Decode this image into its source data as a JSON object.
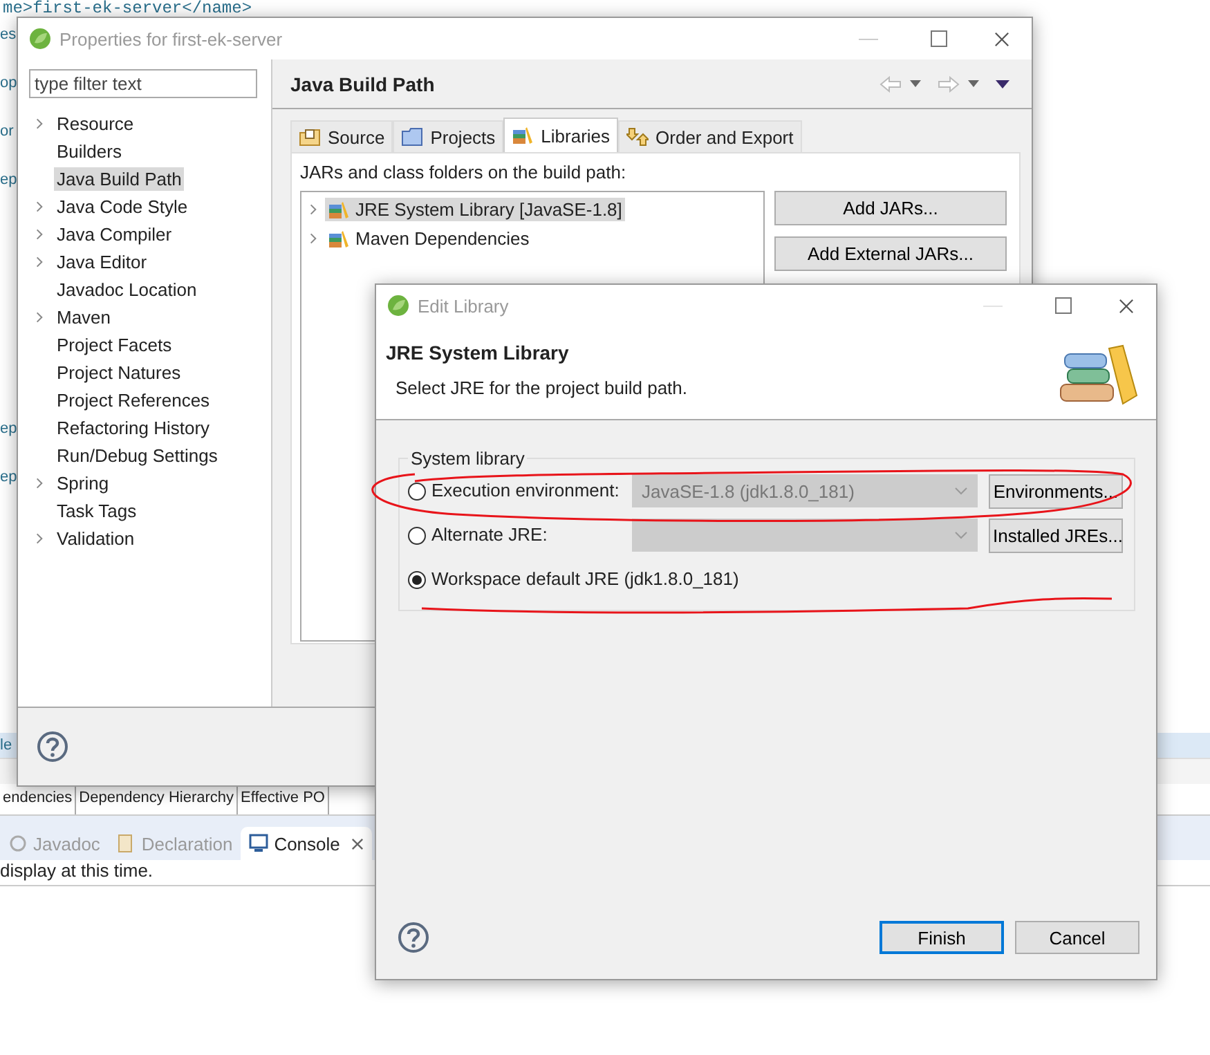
{
  "background_editor": {
    "code_line": "me>first-ek-server</name>",
    "margin_fragments_top": [
      "es",
      "op",
      "or",
      "ep"
    ],
    "margin_fragments_bottom": [
      "ep",
      "ep"
    ],
    "selected_fragment": "le",
    "editor_tabs": [
      {
        "label": "endencies"
      },
      {
        "label": "Dependency Hierarchy"
      },
      {
        "label": "Effective PO"
      }
    ],
    "views": [
      {
        "label": "Javadoc",
        "kind": "javadoc",
        "selected": false
      },
      {
        "label": "Declaration",
        "kind": "declaration",
        "selected": false
      },
      {
        "label": "Console",
        "kind": "console",
        "selected": true
      }
    ],
    "console_text": "display at this time."
  },
  "properties_window": {
    "title": "Properties for first-ek-server",
    "filter": {
      "placeholder": "type filter text"
    },
    "tree": [
      {
        "label": "Resource",
        "expandable": true,
        "selected": false
      },
      {
        "label": "Builders",
        "expandable": false,
        "selected": false
      },
      {
        "label": "Java Build Path",
        "expandable": false,
        "selected": true
      },
      {
        "label": "Java Code Style",
        "expandable": true,
        "selected": false
      },
      {
        "label": "Java Compiler",
        "expandable": true,
        "selected": false
      },
      {
        "label": "Java Editor",
        "expandable": true,
        "selected": false
      },
      {
        "label": "Javadoc Location",
        "expandable": false,
        "selected": false
      },
      {
        "label": "Maven",
        "expandable": true,
        "selected": false
      },
      {
        "label": "Project Facets",
        "expandable": false,
        "selected": false
      },
      {
        "label": "Project Natures",
        "expandable": false,
        "selected": false
      },
      {
        "label": "Project References",
        "expandable": false,
        "selected": false
      },
      {
        "label": "Refactoring History",
        "expandable": false,
        "selected": false
      },
      {
        "label": "Run/Debug Settings",
        "expandable": false,
        "selected": false
      },
      {
        "label": "Spring",
        "expandable": true,
        "selected": false
      },
      {
        "label": "Task Tags",
        "expandable": false,
        "selected": false
      },
      {
        "label": "Validation",
        "expandable": true,
        "selected": false
      }
    ],
    "page_title": "Java Build Path",
    "tabs": [
      {
        "label": "Source",
        "kind": "source",
        "selected": false
      },
      {
        "label": "Projects",
        "kind": "projects",
        "selected": false
      },
      {
        "label": "Libraries",
        "kind": "libraries",
        "selected": true
      },
      {
        "label": "Order and Export",
        "kind": "order",
        "selected": false
      }
    ],
    "content_label": "JARs and class folders on the build path:",
    "libraries": [
      {
        "label": "JRE System Library [JavaSE-1.8]",
        "selected": true
      },
      {
        "label": "Maven Dependencies",
        "selected": false
      }
    ],
    "buttons": [
      "Add JARs...",
      "Add External JARs..."
    ]
  },
  "edit_library": {
    "title": "Edit Library",
    "heading": "JRE System Library",
    "description": "Select JRE for the project build path.",
    "group_label": "System library",
    "options": [
      {
        "kind": "combo",
        "label": "Execution environment:",
        "selected": false,
        "combo_value": "JavaSE-1.8 (jdk1.8.0_181)",
        "button": "Environments..."
      },
      {
        "kind": "combo",
        "label": "Alternate JRE:",
        "selected": false,
        "button": "Installed JREs..."
      },
      {
        "kind": "plain",
        "label": "Workspace default JRE (jdk1.8.0_181)",
        "selected": true
      }
    ],
    "buttons": [
      {
        "label": "Finish",
        "default": true
      },
      {
        "label": "Cancel",
        "default": false
      }
    ]
  }
}
